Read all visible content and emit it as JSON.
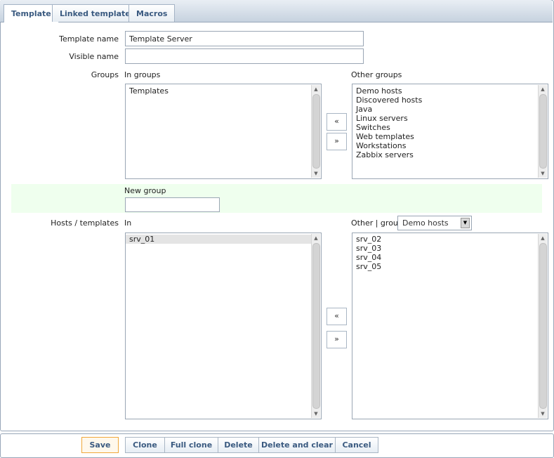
{
  "tabs": [
    {
      "label": "Template",
      "active": true
    },
    {
      "label": "Linked templates",
      "active": false
    },
    {
      "label": "Macros",
      "active": false
    }
  ],
  "form": {
    "template_name_label": "Template name",
    "template_name_value": "Template Server",
    "visible_name_label": "Visible name",
    "visible_name_value": "",
    "groups_label": "Groups",
    "in_groups_label": "In groups",
    "other_groups_label": "Other groups",
    "in_groups": [
      "Templates"
    ],
    "other_groups": [
      "Demo hosts",
      "Discovered hosts",
      "Java",
      "Linux servers",
      "Switches",
      "Web templates",
      "Workstations",
      "Zabbix servers"
    ],
    "new_group_label": "New group",
    "new_group_value": "",
    "hosts_label": "Hosts / templates",
    "in_label": "In",
    "other_group_label": "Other | group",
    "other_group_select": "Demo hosts",
    "in_hosts": [
      "srv_01"
    ],
    "other_hosts": [
      "srv_02",
      "srv_03",
      "srv_04",
      "srv_05"
    ],
    "move_left": "«",
    "move_right": "»"
  },
  "footer": {
    "save": "Save",
    "clone": "Clone",
    "full_clone": "Full clone",
    "delete": "Delete",
    "delete_and_clear": "Delete and clear",
    "cancel": "Cancel"
  },
  "colors": {
    "tab_text": "#3a5a80",
    "new_group_band": "#efffee",
    "save_border": "#f0a73a"
  }
}
